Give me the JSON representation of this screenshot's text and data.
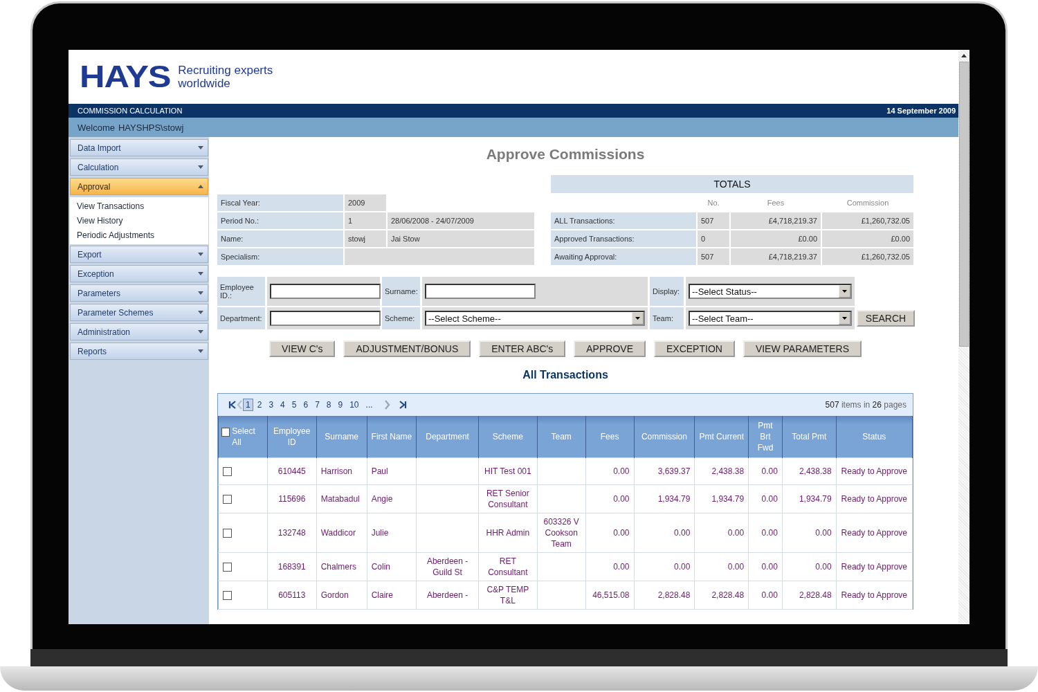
{
  "logo": {
    "brand": "HAYS",
    "tagline_lines": [
      "Recruiting experts",
      "worldwide"
    ]
  },
  "title_bar": {
    "app_name": "COMMISSION CALCULATION",
    "date": "14 September 2009"
  },
  "welcome": {
    "label": "Welcome",
    "user": "HAYSHPS\\stowj"
  },
  "sidebar": {
    "items": [
      {
        "label": "Data Import",
        "selected": false,
        "expanded": false
      },
      {
        "label": "Calculation",
        "selected": false,
        "expanded": false
      },
      {
        "label": "Approval",
        "selected": true,
        "expanded": true,
        "children": [
          {
            "label": "View Transactions"
          },
          {
            "label": "View History"
          },
          {
            "label": "Periodic Adjustments"
          }
        ]
      },
      {
        "label": "Export",
        "selected": false,
        "expanded": false
      },
      {
        "label": "Exception",
        "selected": false,
        "expanded": false
      },
      {
        "label": "Parameters",
        "selected": false,
        "expanded": false
      },
      {
        "label": "Parameter Schemes",
        "selected": false,
        "expanded": false
      },
      {
        "label": "Administration",
        "selected": false,
        "expanded": false
      },
      {
        "label": "Reports",
        "selected": false,
        "expanded": false
      }
    ]
  },
  "page_title": "Approve Commissions",
  "period_info": [
    {
      "label": "Fiscal Year:",
      "value": "2009"
    },
    {
      "label": "Period No.:",
      "value": "1",
      "extra": "28/06/2008 - 24/07/2009"
    },
    {
      "label": "Name:",
      "value": "stowj",
      "extra": "Jai Stow"
    },
    {
      "label": "Specialism:"
    }
  ],
  "totals": {
    "title": "TOTALS",
    "columns": [
      "No.",
      "Fees",
      "Commission"
    ],
    "rows": [
      {
        "label": "ALL Transactions:",
        "values": [
          "507",
          "£4,718,219.37",
          "£1,260,732.05"
        ]
      },
      {
        "label": "Approved Transactions:",
        "values": [
          "0",
          "£0.00",
          "£0.00"
        ]
      },
      {
        "label": "Awaiting Approval:",
        "values": [
          "507",
          "£4,718,219.37",
          "£1,260,732.05"
        ]
      }
    ]
  },
  "filters": [
    {
      "label": "Employee ID.:",
      "kind": "text"
    },
    {
      "label": "Surname:",
      "kind": "text"
    },
    {
      "label": "Display:",
      "kind": "select",
      "value": "--Select Status--"
    },
    {
      "label": "Department:",
      "kind": "text"
    },
    {
      "label": "Scheme:",
      "kind": "select",
      "value": "--Select Scheme--"
    },
    {
      "label": "Team:",
      "kind": "select",
      "value": "--Select Team--"
    }
  ],
  "search_button": "SEARCH",
  "actions": [
    "VIEW C's",
    "ADJUSTMENT/BONUS",
    "ENTER ABC's",
    "APPROVE",
    "EXCEPTION",
    "VIEW PARAMETERS"
  ],
  "grid": {
    "title": "All Transactions",
    "pager": {
      "pages": [
        {
          "label": "1",
          "selected": true
        },
        {
          "label": "2",
          "selected": false
        },
        {
          "label": "3",
          "selected": false
        },
        {
          "label": "4",
          "selected": false
        },
        {
          "label": "5",
          "selected": false
        },
        {
          "label": "6",
          "selected": false
        },
        {
          "label": "7",
          "selected": false
        },
        {
          "label": "8",
          "selected": false
        },
        {
          "label": "9",
          "selected": false
        },
        {
          "label": "10",
          "selected": false
        },
        {
          "label": "...",
          "selected": false
        }
      ],
      "summary": "**507** items in **26** pages"
    },
    "select_all": {
      "label": "Select All",
      "checked": false
    },
    "columns": [
      "Employee ID",
      "Surname",
      "First Name",
      "Department",
      "Scheme",
      "Team",
      "Fees",
      "Commission",
      "Pmt Current",
      "Pmt Brt Fwd",
      "Total Pmt",
      "Status"
    ],
    "rows": [
      {
        "checked": false,
        "cells": [
          "610445",
          "Harrison",
          "Paul",
          "",
          "HIT Test 001",
          "",
          "0.00",
          "3,639.37",
          "2,438.38",
          "0.00",
          "2,438.38",
          "Ready to Approve"
        ]
      },
      {
        "checked": false,
        "cells": [
          "115696",
          "Matabadul",
          "Angie",
          "",
          "RET Senior Consultant",
          "",
          "0.00",
          "1,934.79",
          "1,934.79",
          "0.00",
          "1,934.79",
          "Ready to Approve"
        ]
      },
      {
        "checked": false,
        "cells": [
          "132748",
          "Waddicor",
          "Julie",
          "",
          "HHR Admin",
          "603326 V Cookson Team",
          "0.00",
          "0.00",
          "0.00",
          "0.00",
          "0.00",
          "Ready to Approve"
        ]
      },
      {
        "checked": false,
        "cells": [
          "168391",
          "Chalmers",
          "Colin",
          "Aberdeen - Guild St",
          "RET Consultant",
          "",
          "0.00",
          "0.00",
          "0.00",
          "0.00",
          "0.00",
          "Ready to Approve"
        ]
      },
      {
        "checked": false,
        "cells": [
          "605113",
          "Gordon",
          "Claire",
          "Aberdeen -",
          "C&P TEMP T&L",
          "",
          "46,515.08",
          "2,828.48",
          "2,828.48",
          "0.00",
          "2,828.48",
          "Ready to Approve"
        ]
      }
    ]
  }
}
